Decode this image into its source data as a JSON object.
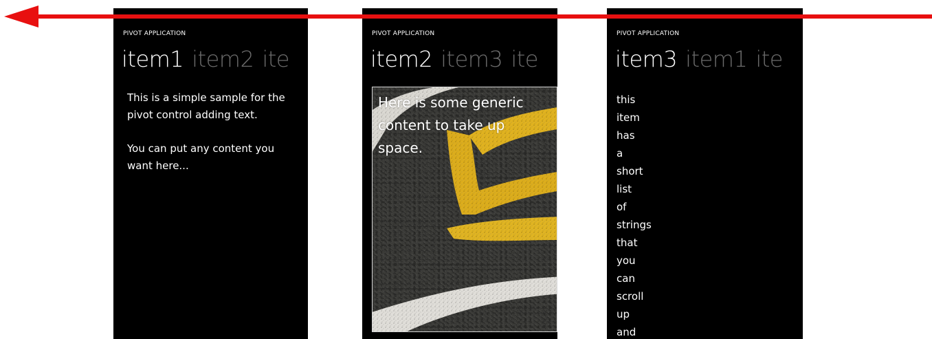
{
  "arrow": {
    "color": "#e81010",
    "direction": "left"
  },
  "screens": [
    {
      "app_title": "PIVOT APPLICATION",
      "headers": [
        "item1",
        "item2",
        "ite"
      ],
      "content": {
        "paragraph1": "This is a simple sample for the pivot control adding text.",
        "paragraph2": "You can put any content you want here..."
      }
    },
    {
      "app_title": "PIVOT APPLICATION",
      "headers": [
        "item2",
        "item3",
        "ite"
      ],
      "content": {
        "text": "Here is some generic content to take up space."
      }
    },
    {
      "app_title": "PIVOT APPLICATION",
      "headers": [
        "item3",
        "item1",
        "ite"
      ],
      "content": {
        "words": [
          "this",
          "item",
          "has",
          "a",
          "short",
          "list",
          "of",
          "strings",
          "that",
          "you",
          "can",
          "scroll",
          "up",
          "and"
        ]
      }
    }
  ]
}
